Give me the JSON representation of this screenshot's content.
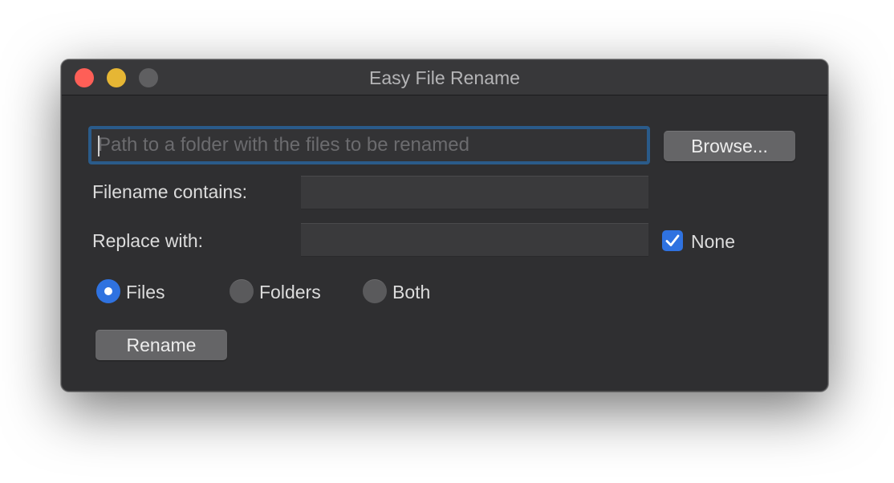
{
  "window": {
    "title": "Easy File Rename"
  },
  "path": {
    "value": "",
    "placeholder": "Path to a folder with the files to be renamed"
  },
  "browse_button": {
    "label": "Browse..."
  },
  "filename_contains": {
    "label": "Filename contains:",
    "value": ""
  },
  "replace_with": {
    "label": "Replace with:",
    "value": ""
  },
  "none_checkbox": {
    "label": "None",
    "checked": true
  },
  "target": {
    "options": [
      {
        "label": "Files",
        "selected": true
      },
      {
        "label": "Folders",
        "selected": false
      },
      {
        "label": "Both",
        "selected": false
      }
    ]
  },
  "rename_button": {
    "label": "Rename"
  },
  "colors": {
    "accent": "#2f72e0",
    "focus_ring": "#2a5b8a",
    "window_bg": "#2f2f31",
    "close": "#fe5f57",
    "minimize": "#e6b634",
    "zoom_disabled": "#5f5f61"
  }
}
